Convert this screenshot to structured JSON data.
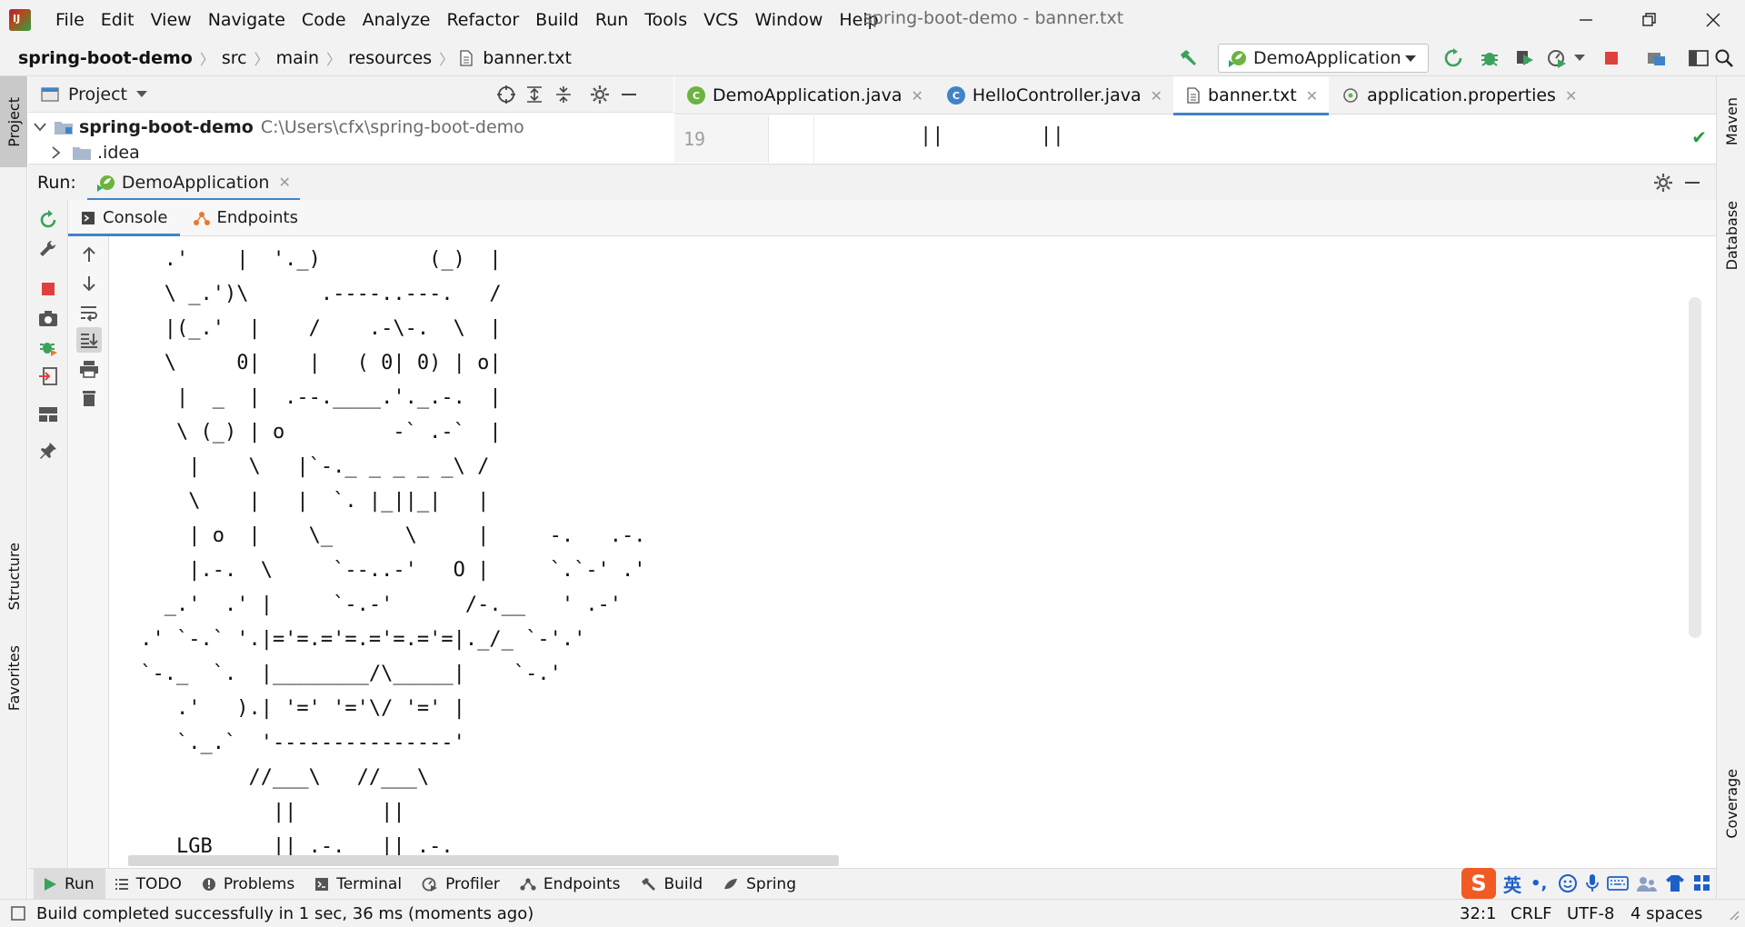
{
  "menu": [
    "File",
    "Edit",
    "View",
    "Navigate",
    "Code",
    "Analyze",
    "Refactor",
    "Build",
    "Run",
    "Tools",
    "VCS",
    "Window",
    "Help"
  ],
  "window_title": "spring-boot-demo - banner.txt",
  "breadcrumb": {
    "project": "spring-boot-demo",
    "items": [
      "src",
      "main",
      "resources"
    ],
    "file": "banner.txt"
  },
  "run_config": "DemoApplication",
  "project_panel": {
    "title": "Project",
    "root": {
      "name": "spring-boot-demo",
      "path": "C:\\Users\\cfx\\spring-boot-demo"
    },
    "child": ".idea"
  },
  "editor": {
    "tabs": [
      {
        "label": "DemoApplication.java",
        "icon": "spring-class-icon"
      },
      {
        "label": "HelloController.java",
        "icon": "class-icon"
      },
      {
        "label": "banner.txt",
        "icon": "text-file-icon",
        "active": true
      },
      {
        "label": "application.properties",
        "icon": "properties-icon"
      }
    ],
    "line_number": "19",
    "line_text": "||        ||"
  },
  "run_panel": {
    "label": "Run:",
    "tab": "DemoApplication",
    "subtabs": [
      "Console",
      "Endpoints"
    ]
  },
  "console_lines": [
    "   .'    |  '._)         (_)  |",
    "   \\ _.')\\      .----..---.   /",
    "   |(_.'  |    /    .-\\-.  \\  |",
    "   \\     0|    |   ( 0| 0) | o|",
    "    |  _  |  .--.____.'._.-.  |",
    "    \\ (_) | o         -` .-`  |",
    "     |    \\   |`-._ _ _ _ _\\ /",
    "     \\    |   |  `. |_||_|   |",
    "     | o  |    \\_      \\     |     -.   .-.",
    "     |.-.  \\     `--..-'   O |     `.`-' .'",
    "   _.'  .' |     `-.-'      /-.__   ' .-'",
    " .' `-.` '.|='=.='=.='=.='=|._/_ `-'.'",
    " `-._  `.  |________/\\_____|    `-.'",
    "    .'   ).| '=' '='\\/ '=' |",
    "    `._.`  '---------------'",
    "          //___\\   //___\\",
    "            ||       ||",
    "    LGB     ||_.-.   ||_.-."
  ],
  "bottom_tabs": [
    {
      "label": "Run",
      "icon": "run-icon",
      "active": true
    },
    {
      "label": "TODO",
      "icon": "list-icon"
    },
    {
      "label": "Problems",
      "icon": "problems-icon"
    },
    {
      "label": "Terminal",
      "icon": "terminal-icon"
    },
    {
      "label": "Profiler",
      "icon": "profiler-icon"
    },
    {
      "label": "Endpoints",
      "icon": "endpoints-icon"
    },
    {
      "label": "Build",
      "icon": "hammer-icon"
    },
    {
      "label": "Spring",
      "icon": "spring-icon"
    }
  ],
  "left_stripe": {
    "top": "Project",
    "structure": "Structure",
    "favorites": "Favorites"
  },
  "right_stripe": {
    "maven": "Maven",
    "database": "Database",
    "coverage": "Coverage"
  },
  "status": {
    "message": "Build completed successfully in 1 sec, 36 ms (moments ago)",
    "position": "32:1",
    "line_sep": "CRLF",
    "encoding": "UTF-8",
    "indent": "4 spaces"
  },
  "ime": {
    "lang": "英",
    "punct": "•,"
  },
  "colors": {
    "accent": "#4083c9",
    "run_green": "#3aa25a",
    "stop_red": "#e0403c",
    "spring_green": "#6db33f"
  }
}
